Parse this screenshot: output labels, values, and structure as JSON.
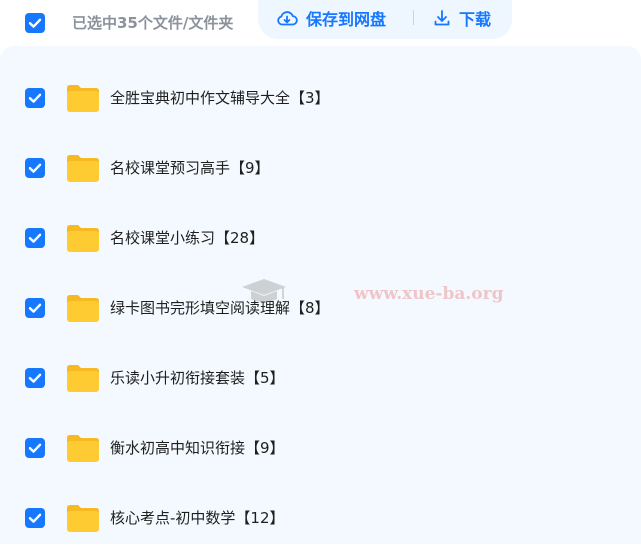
{
  "toolbar": {
    "selected_text": "已选中35个文件/文件夹",
    "save_label": "保存到网盘",
    "download_label": "下载"
  },
  "watermark": {
    "text": "www.xue-ba.org"
  },
  "files": [
    {
      "name": "全胜宝典初中作文辅导大全【3】",
      "checked": true
    },
    {
      "name": "名校课堂预习高手【9】",
      "checked": true
    },
    {
      "name": "名校课堂小练习【28】",
      "checked": true
    },
    {
      "name": "绿卡图书完形填空阅读理解【8】",
      "checked": true
    },
    {
      "name": "乐读小升初衔接套装【5】",
      "checked": true
    },
    {
      "name": "衡水初高中知识衔接【9】",
      "checked": true
    },
    {
      "name": "核心考点-初中数学【12】",
      "checked": true
    }
  ],
  "colors": {
    "accent": "#1677ff",
    "folder": "#ffcb33",
    "folder_tab": "#f7b922",
    "panel_bg": "#f3f9fe",
    "muted_text": "#8a929c"
  }
}
